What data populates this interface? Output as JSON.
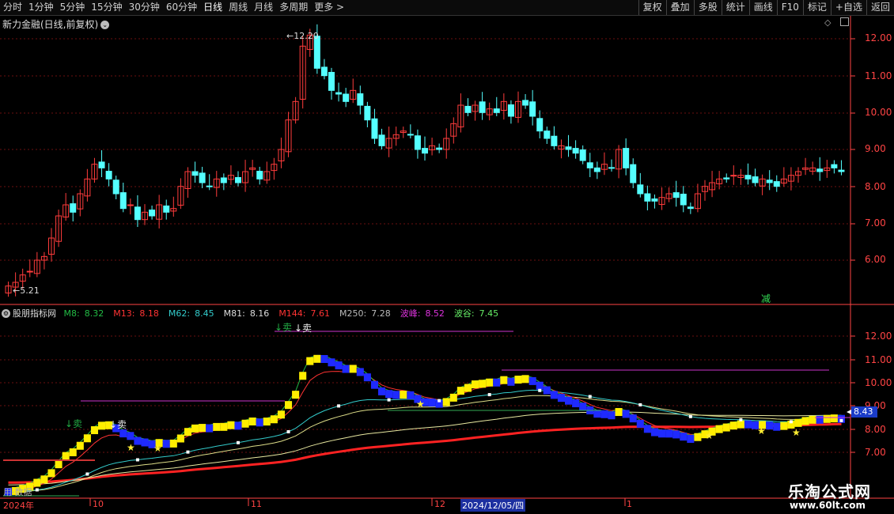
{
  "toolbar": {
    "periods": [
      "分时",
      "1分钟",
      "5分钟",
      "15分钟",
      "30分钟",
      "60分钟",
      "日线",
      "周线",
      "月线",
      "多周期",
      "更多 >"
    ],
    "active_period": "日线",
    "right_buttons": [
      "复权",
      "叠加",
      "多股",
      "统计",
      "画线",
      "F10",
      "标记",
      "+自选",
      "返回"
    ]
  },
  "main": {
    "title": "新力金融(日线,前复权)",
    "high_label": "12.20",
    "low_label": "5.21",
    "reduce_tag": "减",
    "axis_ticks": [
      "12.00",
      "11.00",
      "10.00",
      "9.00",
      "8.00",
      "7.00",
      "6.00"
    ]
  },
  "indicator": {
    "name": "股朋指标网",
    "readouts": [
      {
        "label": "M8:",
        "value": "8.32",
        "color": "#22bb44"
      },
      {
        "label": "M13:",
        "value": "8.18",
        "color": "#ff3333"
      },
      {
        "label": "M62:",
        "value": "8.45",
        "color": "#33cccc"
      },
      {
        "label": "M81:",
        "value": "8.16",
        "color": "#dddddd"
      },
      {
        "label": "M144:",
        "value": "7.61",
        "color": "#ff3333"
      },
      {
        "label": "M250:",
        "value": "7.28",
        "color": "#bbbbbb"
      },
      {
        "label": "波峰:",
        "value": "8.52",
        "color": "#dd33dd"
      },
      {
        "label": "波谷:",
        "value": "7.45",
        "color": "#66ee66"
      }
    ],
    "axis_ticks": [
      "12.00",
      "11.00",
      "10.00",
      "9.00",
      "8.00",
      "7.00"
    ],
    "current_value": "8.43",
    "sell_labels": [
      "↓卖",
      "↓卖",
      "↓卖",
      "↓卖"
    ],
    "bottom_note": "用·数据"
  },
  "dates": [
    "2024年",
    "10",
    "11",
    "12",
    "2024/12/05/四",
    "1"
  ],
  "watermark": {
    "name": "乐淘公式网",
    "url": "www.60lt.com"
  },
  "colors": {
    "up": "#ff3c3c",
    "down": "#54ffff",
    "axis": "#ff4444"
  }
}
